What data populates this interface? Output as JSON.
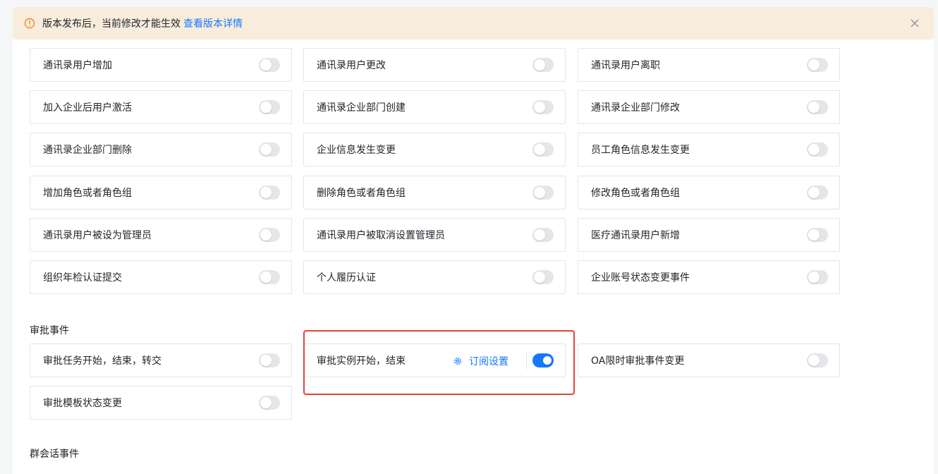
{
  "notice": {
    "message": "版本发布后，当前修改才能生效",
    "link": "查看版本详情",
    "icon": "info-icon",
    "close_icon": "close-icon"
  },
  "contact_events": [
    {
      "label": "通讯录用户增加",
      "enabled": false
    },
    {
      "label": "通讯录用户更改",
      "enabled": false
    },
    {
      "label": "通讯录用户离职",
      "enabled": false
    },
    {
      "label": "加入企业后用户激活",
      "enabled": false
    },
    {
      "label": "通讯录企业部门创建",
      "enabled": false
    },
    {
      "label": "通讯录企业部门修改",
      "enabled": false
    },
    {
      "label": "通讯录企业部门删除",
      "enabled": false
    },
    {
      "label": "企业信息发生变更",
      "enabled": false
    },
    {
      "label": "员工角色信息发生变更",
      "enabled": false
    },
    {
      "label": "增加角色或者角色组",
      "enabled": false
    },
    {
      "label": "删除角色或者角色组",
      "enabled": false
    },
    {
      "label": "修改角色或者角色组",
      "enabled": false
    },
    {
      "label": "通讯录用户被设为管理员",
      "enabled": false
    },
    {
      "label": "通讯录用户被取消设置管理员",
      "enabled": false
    },
    {
      "label": "医疗通讯录用户新增",
      "enabled": false
    },
    {
      "label": "组织年检认证提交",
      "enabled": false
    },
    {
      "label": "个人履历认证",
      "enabled": false
    },
    {
      "label": "企业账号状态变更事件",
      "enabled": false
    }
  ],
  "approval": {
    "title": "审批事件",
    "events": [
      {
        "label": "审批任务开始，结束，转交",
        "enabled": false
      },
      {
        "label": "审批实例开始，结束",
        "enabled": true,
        "action": "订阅设置",
        "action_icon": "gear-icon"
      },
      {
        "label": "OA限时审批事件变更",
        "enabled": false
      },
      {
        "label": "审批模板状态变更",
        "enabled": false
      }
    ]
  },
  "next_section": {
    "title": "群会话事件"
  },
  "colors": {
    "accent": "#1677ff",
    "notice_bg": "#f8ecdc",
    "highlight": "#e0433b"
  }
}
